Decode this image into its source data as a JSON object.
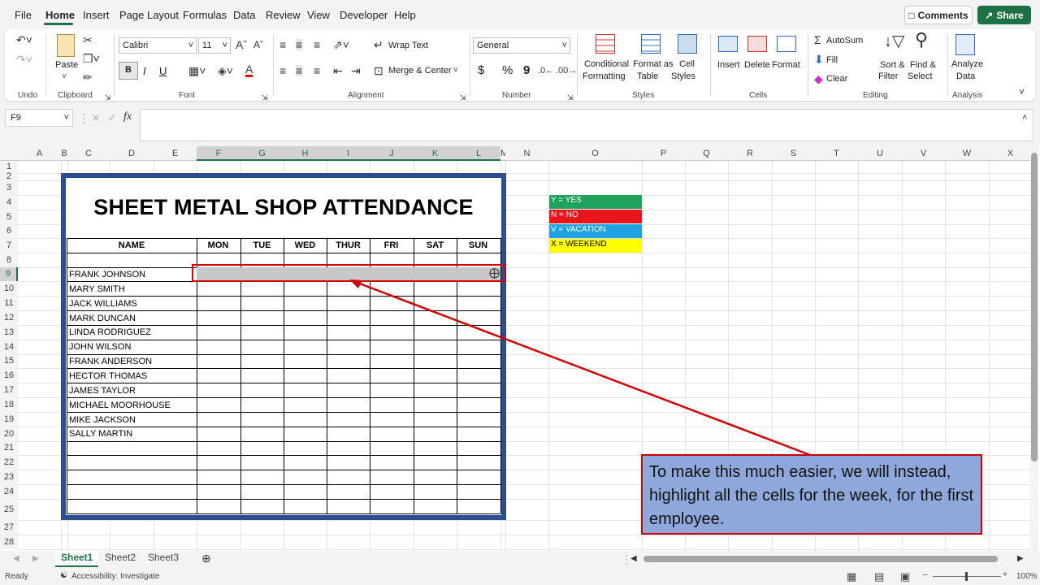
{
  "menu": {
    "file": "File",
    "home": "Home",
    "insert": "Insert",
    "page_layout": "Page Layout",
    "formulas": "Formulas",
    "data": "Data",
    "review": "Review",
    "view": "View",
    "developer": "Developer",
    "help": "Help"
  },
  "top_buttons": {
    "comments": "Comments",
    "share": "Share"
  },
  "ribbon": {
    "undo": {
      "label": "Undo"
    },
    "clipboard": {
      "label": "Clipboard",
      "paste": "Paste"
    },
    "font": {
      "label": "Font",
      "name": "Calibri",
      "size": "11",
      "bold": "B",
      "italic": "I",
      "underline": "U"
    },
    "alignment": {
      "label": "Alignment",
      "wrap_text": "Wrap Text",
      "merge_center": "Merge & Center"
    },
    "number": {
      "label": "Number",
      "format": "General",
      "currency": "$",
      "percent": "%",
      "comma": "9"
    },
    "styles": {
      "label": "Styles",
      "conditional_1": "Conditional",
      "conditional_2": "Formatting",
      "format_table_1": "Format as",
      "format_table_2": "Table",
      "cell_styles_1": "Cell",
      "cell_styles_2": "Styles"
    },
    "cells": {
      "label": "Cells",
      "insert": "Insert",
      "delete": "Delete",
      "format": "Format"
    },
    "editing": {
      "label": "Editing",
      "autosum": "AutoSum",
      "fill": "Fill",
      "clear": "Clear",
      "sort_1": "Sort &",
      "sort_2": "Filter",
      "find_1": "Find &",
      "find_2": "Select"
    },
    "analysis": {
      "label": "Analysis",
      "analyze_1": "Analyze",
      "analyze_2": "Data"
    }
  },
  "formula_bar": {
    "name_box": "F9",
    "fx": "fx",
    "formula": ""
  },
  "columns": [
    "A",
    "B",
    "C",
    "D",
    "E",
    "F",
    "G",
    "H",
    "I",
    "J",
    "K",
    "L",
    "M",
    "N",
    "O",
    "P",
    "Q",
    "R",
    "S",
    "T",
    "U",
    "V",
    "W",
    "X"
  ],
  "rows": [
    "1",
    "2",
    "3",
    "4",
    "5",
    "6",
    "7",
    "8",
    "9",
    "10",
    "11",
    "12",
    "13",
    "14",
    "15",
    "16",
    "17",
    "18",
    "19",
    "20",
    "21",
    "22",
    "23",
    "24",
    "25",
    "27",
    "28"
  ],
  "sheet": {
    "title": "SHEET METAL SHOP ATTENDANCE",
    "name_header": "NAME",
    "days": [
      "MON",
      "TUE",
      "WED",
      "THUR",
      "FRI",
      "SAT",
      "SUN"
    ],
    "employees": [
      "FRANK JOHNSON",
      "MARY SMITH",
      "JACK WILLIAMS",
      "MARK DUNCAN",
      "LINDA RODRIGUEZ",
      "JOHN WILSON",
      "FRANK ANDERSON",
      "HECTOR THOMAS",
      "JAMES TAYLOR",
      "MICHAEL MOORHOUSE",
      "MIKE JACKSON",
      "SALLY MARTIN"
    ]
  },
  "legend": [
    {
      "text": "Y = YES",
      "color": "#1fa35a"
    },
    {
      "text": "N = NO",
      "color": "#e8161b"
    },
    {
      "text": "V = VACATION",
      "color": "#1ea2e0"
    },
    {
      "text": "X = WEEKEND",
      "color": "#ffff00"
    }
  ],
  "callout": {
    "text": "To make this much easier, we will instead, highlight all the cells for the week, for the first employee."
  },
  "sheet_tabs": [
    "Sheet1",
    "Sheet2",
    "Sheet3"
  ],
  "status": {
    "ready": "Ready",
    "accessibility": "Accessibility: Investigate",
    "zoom": "100%"
  },
  "colors": {
    "accent": "#1e7145",
    "frame": "#2e4f8f",
    "callout_bg": "#8fa8dc",
    "callout_border": "#d10000",
    "selection": "#c8c8c8"
  }
}
